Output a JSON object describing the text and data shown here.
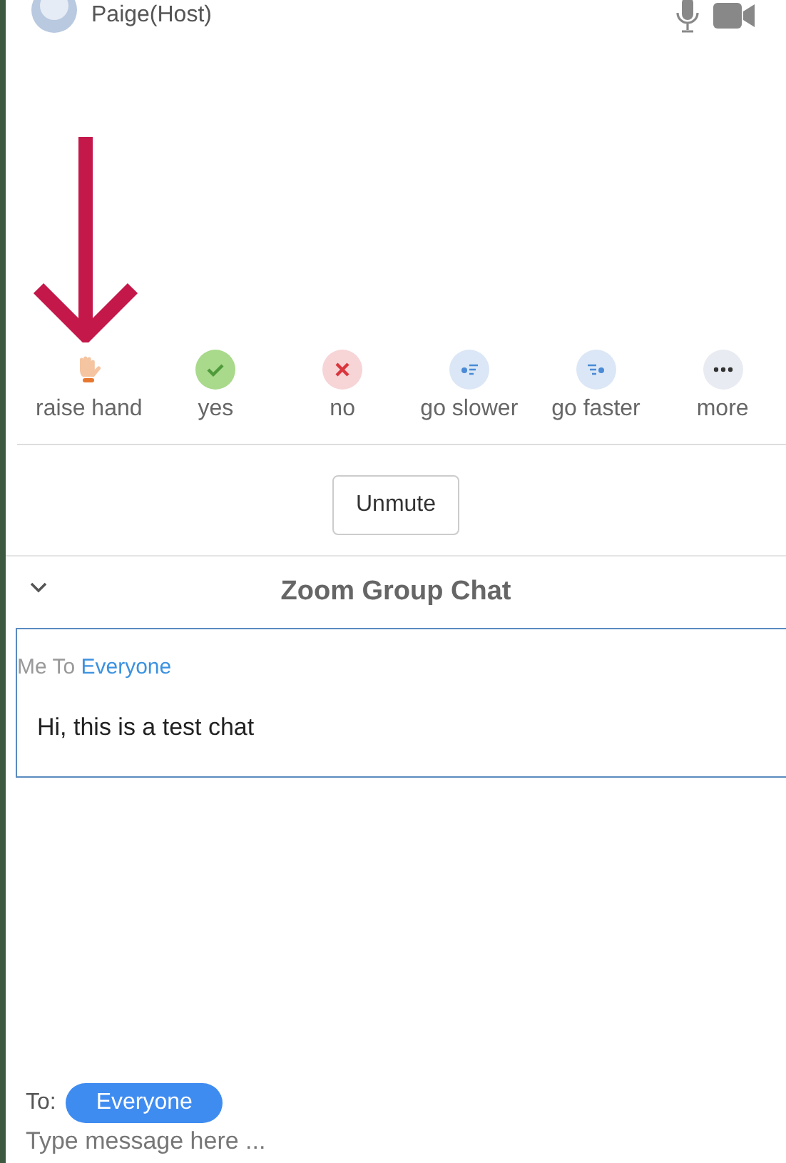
{
  "participant": {
    "name": "Paige(Host)"
  },
  "reactions": [
    {
      "kind": "raise_hand",
      "label": "raise hand"
    },
    {
      "kind": "yes",
      "label": "yes"
    },
    {
      "kind": "no",
      "label": "no"
    },
    {
      "kind": "slower",
      "label": "go slower"
    },
    {
      "kind": "faster",
      "label": "go faster"
    },
    {
      "kind": "more",
      "label": "more"
    }
  ],
  "unmute_button": "Unmute",
  "chat": {
    "title": "Zoom Group Chat",
    "messages": [
      {
        "sender": "Me To",
        "recipient": "Everyone",
        "text": "Hi, this is a test chat"
      }
    ],
    "to_label": "To:",
    "recipient": "Everyone",
    "placeholder": "Type message here ..."
  }
}
